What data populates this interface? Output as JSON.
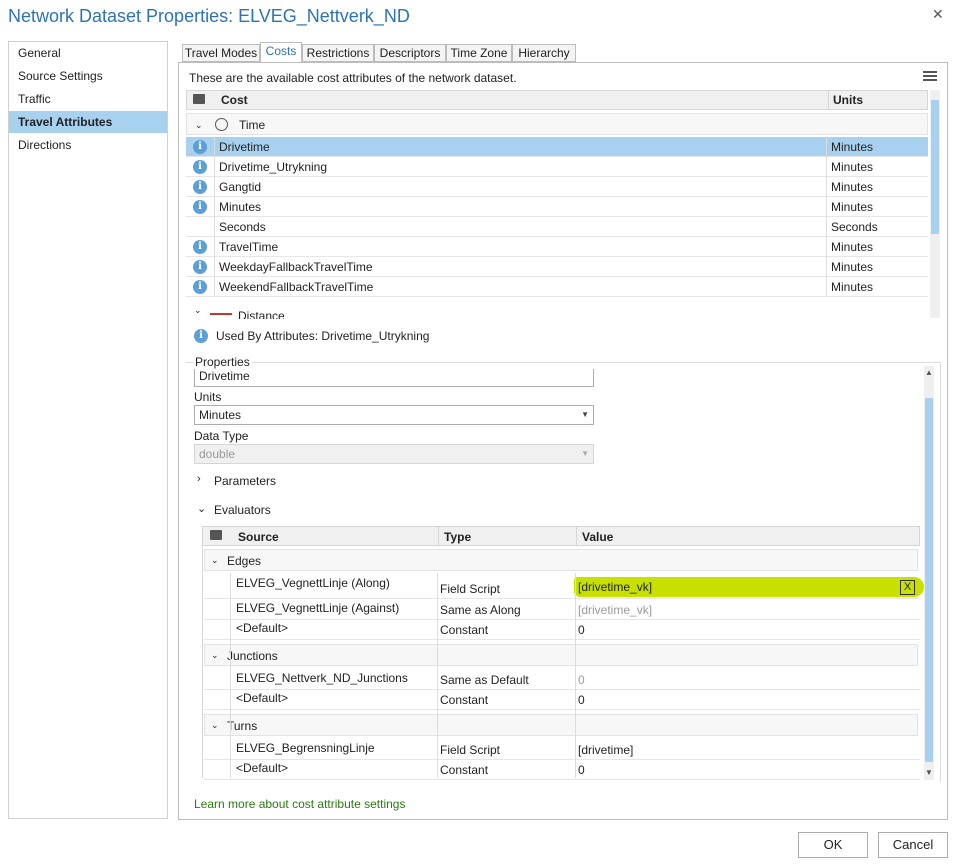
{
  "window": {
    "title": "Network Dataset Properties: ELVEG_Nettverk_ND"
  },
  "nav": [
    "General",
    "Source Settings",
    "Traffic",
    "Travel Attributes",
    "Directions"
  ],
  "tabs": [
    "Travel Modes",
    "Costs",
    "Restrictions",
    "Descriptors",
    "Time Zone",
    "Hierarchy"
  ],
  "costs": {
    "description": "These are the available cost attributes of the network dataset.",
    "col_cost": "Cost",
    "col_units": "Units",
    "group_time": "Time",
    "group_distance": "Distance",
    "rows": [
      {
        "name": "Drivetime",
        "units": "Minutes"
      },
      {
        "name": "Drivetime_Utrykning",
        "units": "Minutes"
      },
      {
        "name": "Gangtid",
        "units": "Minutes"
      },
      {
        "name": "Minutes",
        "units": "Minutes"
      },
      {
        "name": "Seconds",
        "units": "Seconds"
      },
      {
        "name": "TravelTime",
        "units": "Minutes"
      },
      {
        "name": "WeekdayFallbackTravelTime",
        "units": "Minutes"
      },
      {
        "name": "WeekendFallbackTravelTime",
        "units": "Minutes"
      }
    ],
    "used_by": "Used By Attributes: Drivetime_Utrykning"
  },
  "properties": {
    "heading": "Properties",
    "name_value": "Drivetime",
    "units_label": "Units",
    "units_value": "Minutes",
    "datatype_label": "Data Type",
    "datatype_value": "double",
    "parameters": "Parameters",
    "evaluators": "Evaluators"
  },
  "evaluators": {
    "col_source": "Source",
    "col_type": "Type",
    "col_value": "Value",
    "edges": "Edges",
    "junctions": "Junctions",
    "turns": "Turns",
    "e1": {
      "source": "ELVEG_VegnettLinje (Along)",
      "type": "Field Script",
      "value": "[drivetime_vk]"
    },
    "e2": {
      "source": "ELVEG_VegnettLinje (Against)",
      "type": "Same as Along",
      "value": "[drivetime_vk]"
    },
    "e3": {
      "source": "<Default>",
      "type": "Constant",
      "value": "0"
    },
    "j1": {
      "source": "ELVEG_Nettverk_ND_Junctions",
      "type": "Same as Default",
      "value": "0"
    },
    "j2": {
      "source": "<Default>",
      "type": "Constant",
      "value": "0"
    },
    "t1": {
      "source": "ELVEG_BegrensningLinje",
      "type": "Field Script",
      "value": "[drivetime]"
    },
    "t2": {
      "source": "<Default>",
      "type": "Constant",
      "value": "0"
    },
    "clear_glyph": "X"
  },
  "learn_more": "Learn more about cost attribute settings",
  "buttons": {
    "ok": "OK",
    "cancel": "Cancel"
  },
  "colors": {
    "accent": "#2d73b4",
    "selection": "#a8d1ef",
    "highlight": "#c7e000",
    "link": "#2b7a12"
  }
}
